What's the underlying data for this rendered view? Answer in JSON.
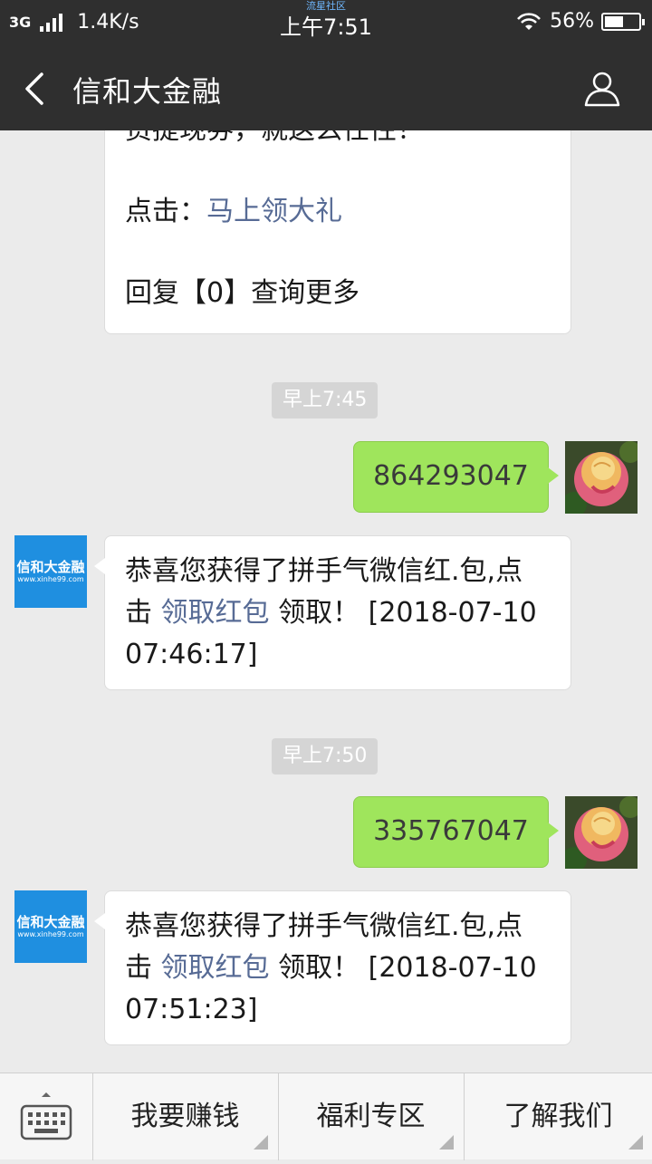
{
  "status_bar": {
    "network": "3G",
    "speed": "1.4K/s",
    "time": "上午7:51",
    "watermark": "流星社区",
    "battery": "56%",
    "battery_level": 0.56
  },
  "header": {
    "title": "信和大金融",
    "back_icon": "back-chevron-icon",
    "profile_icon": "person-icon"
  },
  "messages": {
    "m0": {
      "line1": "资提现券，就这么任性！",
      "line2_prefix": "点击：",
      "line2_link": "马上领大礼",
      "line3": "回复【0】查询更多"
    },
    "t1": "早上7:45",
    "s1": "864293047",
    "r1": {
      "line1": "恭喜您获得了拼手气微信红.包,点",
      "line2_prefix": "击 ",
      "line2_link": "领取红包",
      "line2_suffix": " 领取！ [2018-07-10",
      "line3": "07:46:17]"
    },
    "t2": "早上7:50",
    "s2": "335767047",
    "r2": {
      "line1": "恭喜您获得了拼手气微信红.包,点",
      "line2_prefix": "击 ",
      "line2_link": "领取红包",
      "line2_suffix": " 领取！ [2018-07-10",
      "line3": "07:51:23]"
    }
  },
  "brand_avatar": {
    "name": "信和大金融",
    "url": "www.xinhe99.com"
  },
  "bottom_menu": {
    "keyboard_icon": "keyboard-icon",
    "items": [
      {
        "label": "我要赚钱"
      },
      {
        "label": "福利专区"
      },
      {
        "label": "了解我们"
      }
    ]
  },
  "colors": {
    "header_bg": "#2f2f2f",
    "sent_bubble": "#9fe55c",
    "link": "#576b95",
    "brand": "#1f8fe0"
  }
}
